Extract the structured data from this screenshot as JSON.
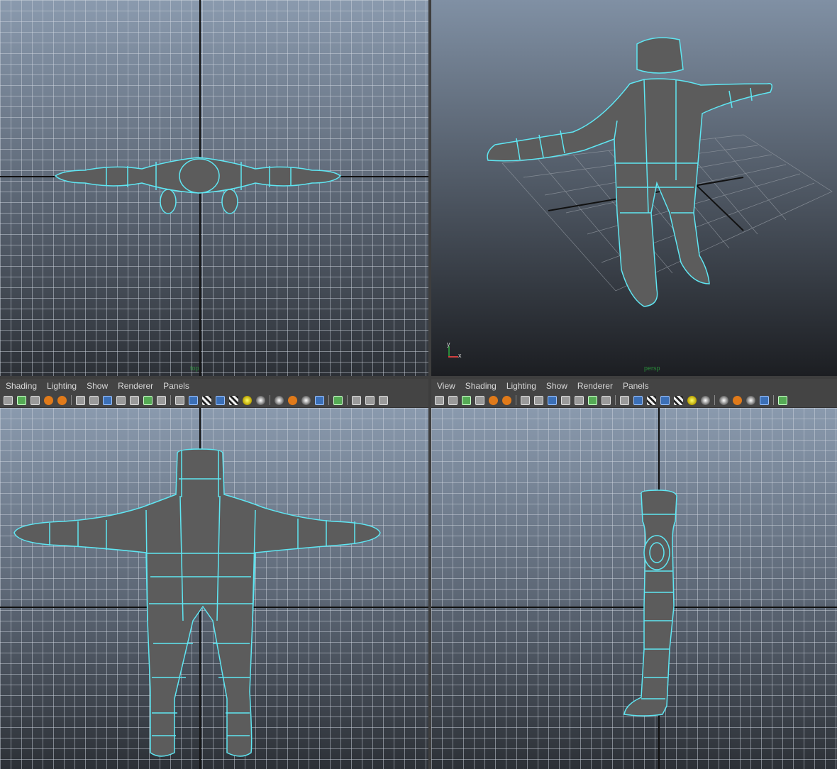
{
  "panels": {
    "top": {
      "camera_label": "top"
    },
    "persp": {
      "camera_label": "persp",
      "axis": {
        "y": "y",
        "x": "x"
      }
    },
    "front": {
      "menu": [
        "Shading",
        "Lighting",
        "Show",
        "Renderer",
        "Panels"
      ]
    },
    "side": {
      "menu": [
        "View",
        "Shading",
        "Lighting",
        "Show",
        "Renderer",
        "Panels"
      ]
    }
  },
  "toolbar_icons": [
    "select-camera-icon",
    "camera-attributes-icon",
    "bookmark-icon",
    "image-plane-icon",
    "2d-pan-icon",
    "grease-pencil-icon",
    "wireframe-icon",
    "grid-icon",
    "smooth-shade-icon",
    "default-material-icon",
    "xray-icon",
    "isolate-icon",
    "texture-icon",
    "resolution-gate-icon",
    "cube-icon",
    "shaded-cube-icon",
    "wire-on-shaded-icon",
    "cube-outline-icon",
    "checker-icon",
    "light-icon",
    "sphere-icon",
    "headlight-icon",
    "shadow-icon",
    "ambient-occlusion-icon",
    "motion-blur-icon",
    "select-icon",
    "camera-gate-icon",
    "film-gate-icon",
    "share-icon"
  ],
  "colors": {
    "wire": "#5fe6f2",
    "mesh": "#5c5c5c"
  }
}
